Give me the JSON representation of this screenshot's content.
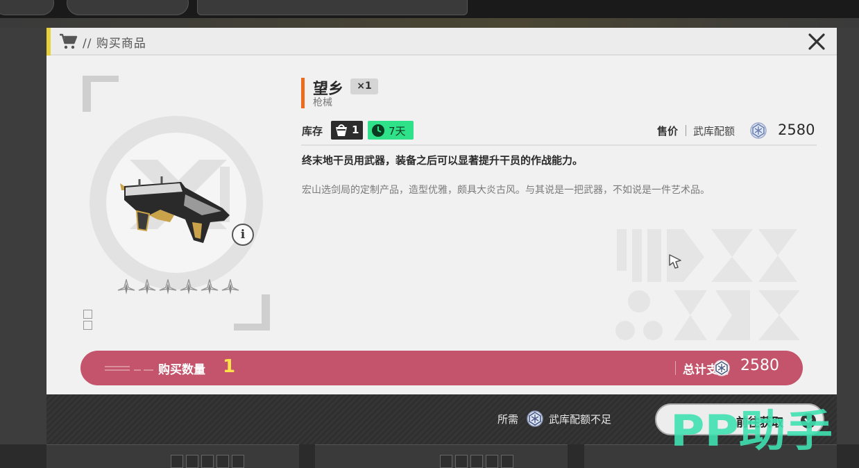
{
  "dialog": {
    "title": "// 购买商品",
    "icons": {
      "cart": "cart-icon",
      "close": "close-icon",
      "info": "info-icon",
      "currency": "arsenal-coin-icon"
    }
  },
  "item": {
    "name": "望乡",
    "count": "×1",
    "type": "枪械",
    "rarity_stars": 6,
    "stock_label": "库存",
    "stock_value": "1",
    "time_value": "7天",
    "price_label": "售价",
    "currency_name": "武库配额",
    "price": "2580",
    "description": "终末地干员用武器，装备之后可以显著提升干员的作战能力。",
    "flavor": "宏山选剑局的定制产品，造型优雅，颇具大炎古风。与其说是一把武器，不如说是一件艺术品。"
  },
  "purchase": {
    "qty_label": "购买数量",
    "qty_value": "1",
    "total_label": "总计支付",
    "total_value": "2580"
  },
  "footer": {
    "need_label": "所需",
    "need_text": "武库配额不足",
    "go_label": "前往获取"
  },
  "watermark": {
    "text": "PP助手"
  },
  "colors": {
    "accent_yellow": "#e6d13a",
    "name_bar": "#ee6b1e",
    "qty_bar": "#c4546b",
    "qty_value": "#ffe14a",
    "time_badge": "#2fe28a"
  }
}
